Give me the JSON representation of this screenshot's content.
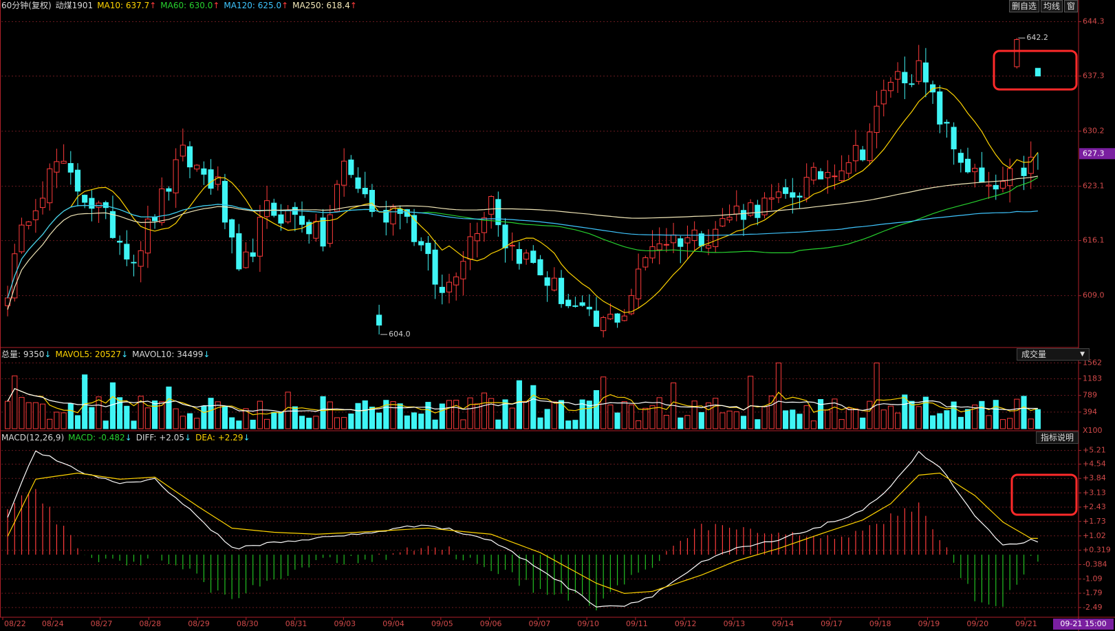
{
  "header": {
    "period": "60分钟(复权)",
    "symbol": "动煤1901",
    "ma10": "MA10: 637.7",
    "ma60": "MA60: 630.0",
    "ma120": "MA120: 625.0",
    "ma250": "MA250: 618.4",
    "up_arrow": "↑",
    "down_arrow": "↓"
  },
  "top_buttons": [
    "删自选",
    "均线",
    "窗"
  ],
  "volume_header": {
    "total": "总量: 9350",
    "mavol5": "MAVOL5: 20527",
    "mavol10": "MAVOL10: 34499"
  },
  "volume_button": "成交量",
  "volume_dropdown_icon": "▼",
  "macd_header": {
    "name": "MACD(12,26,9)",
    "macd": "MACD: -0.482",
    "diff": "DIFF: +2.05",
    "dea": "DEA: +2.29"
  },
  "macd_button": "指标说明",
  "x_axis_labels": [
    "08/22",
    "08/24",
    "08/27",
    "08/28",
    "08/29",
    "08/30",
    "08/31",
    "09/03",
    "09/04",
    "09/05",
    "09/06",
    "09/07",
    "09/10",
    "09/11",
    "09/12",
    "09/13",
    "09/14",
    "09/17",
    "09/18",
    "09/19",
    "09/20",
    "09/21"
  ],
  "time_badge": "09-21 15:00",
  "current_price_badge": "627.3",
  "colors": {
    "up": "#ff3b3b",
    "down": "#3ff5f5",
    "ma10": "#ffd400",
    "ma60": "#27d12e",
    "ma120": "#3fc6ff",
    "ma250": "#f2e7b8",
    "diff": "#ffffff",
    "dea": "#ffd400",
    "highlight_box": "#ff2a2a",
    "badge_bg": "#7a1fa0"
  },
  "chart_data": [
    {
      "type": "candlestick",
      "y_ticks": [
        "644.3",
        "637.3",
        "630.2",
        "623.1",
        "616.1",
        "609.0"
      ],
      "ylim": [
        602.5,
        645.5
      ],
      "annotations": [
        {
          "label": "642.2"
        },
        {
          "label": "604.0"
        }
      ],
      "current_price": 627.3,
      "n_bars": 140,
      "anchors_close": [
        [
          0,
          610
        ],
        [
          3,
          620
        ],
        [
          7,
          626
        ],
        [
          13,
          620
        ],
        [
          18,
          614
        ],
        [
          25,
          627
        ],
        [
          30,
          623
        ],
        [
          33,
          611
        ],
        [
          37,
          620
        ],
        [
          42,
          619
        ],
        [
          45,
          616
        ],
        [
          48,
          626
        ],
        [
          53,
          619
        ],
        [
          56,
          621
        ],
        [
          62,
          609
        ],
        [
          69,
          622
        ],
        [
          71,
          616
        ],
        [
          75,
          613
        ],
        [
          80,
          608
        ],
        [
          84,
          605
        ],
        [
          88,
          607
        ],
        [
          92,
          616
        ],
        [
          100,
          617
        ],
        [
          104,
          620
        ],
        [
          110,
          621
        ],
        [
          115,
          624
        ],
        [
          122,
          628
        ],
        [
          126,
          637
        ],
        [
          130,
          638
        ],
        [
          135,
          628
        ],
        [
          140,
          622
        ],
        [
          146,
          626
        ]
      ],
      "series_ma": [
        "MA10",
        "MA60",
        "MA120",
        "MA250"
      ]
    },
    {
      "type": "bar",
      "name": "volume",
      "y_ticks": [
        "1562",
        "1183",
        "789",
        "394"
      ],
      "unit": "X100",
      "ylim": [
        0,
        1600
      ]
    },
    {
      "type": "macd",
      "y_ticks": [
        "+5.21",
        "+4.54",
        "+3.84",
        "+3.13",
        "+2.43",
        "+1.73",
        "+1.02",
        "+0.319",
        "-0.384",
        "-1.09",
        "-1.79",
        "-2.49"
      ],
      "ylim": [
        -2.9,
        5.5
      ],
      "diff_anchors": [
        [
          0,
          2.0
        ],
        [
          4,
          5.21
        ],
        [
          10,
          4.2
        ],
        [
          16,
          3.6
        ],
        [
          21,
          3.8
        ],
        [
          27,
          2.0
        ],
        [
          32,
          0.4
        ],
        [
          38,
          0.7
        ],
        [
          44,
          0.9
        ],
        [
          50,
          1.1
        ],
        [
          60,
          1.6
        ],
        [
          69,
          0.8
        ],
        [
          76,
          -0.6
        ],
        [
          84,
          -2.4
        ],
        [
          88,
          -2.4
        ],
        [
          92,
          -1.9
        ],
        [
          99,
          -0.3
        ],
        [
          104,
          0.4
        ],
        [
          110,
          0.8
        ],
        [
          115,
          1.4
        ],
        [
          122,
          2.2
        ],
        [
          126,
          3.5
        ],
        [
          130,
          5.1
        ],
        [
          133,
          4.4
        ],
        [
          138,
          2.0
        ],
        [
          142,
          0.5
        ],
        [
          146,
          0.8
        ]
      ],
      "dea_anchors": [
        [
          0,
          1.0
        ],
        [
          4,
          3.8
        ],
        [
          10,
          4.1
        ],
        [
          16,
          3.8
        ],
        [
          21,
          3.9
        ],
        [
          27,
          2.5
        ],
        [
          32,
          1.4
        ],
        [
          38,
          1.2
        ],
        [
          44,
          1.1
        ],
        [
          50,
          1.2
        ],
        [
          60,
          1.4
        ],
        [
          69,
          1.1
        ],
        [
          76,
          0.2
        ],
        [
          84,
          -1.3
        ],
        [
          88,
          -1.8
        ],
        [
          92,
          -1.7
        ],
        [
          99,
          -0.9
        ],
        [
          104,
          -0.2
        ],
        [
          110,
          0.4
        ],
        [
          115,
          1.0
        ],
        [
          122,
          1.8
        ],
        [
          126,
          2.6
        ],
        [
          130,
          4.0
        ],
        [
          133,
          4.1
        ],
        [
          138,
          3.0
        ],
        [
          142,
          1.7
        ],
        [
          146,
          0.9
        ]
      ]
    }
  ]
}
